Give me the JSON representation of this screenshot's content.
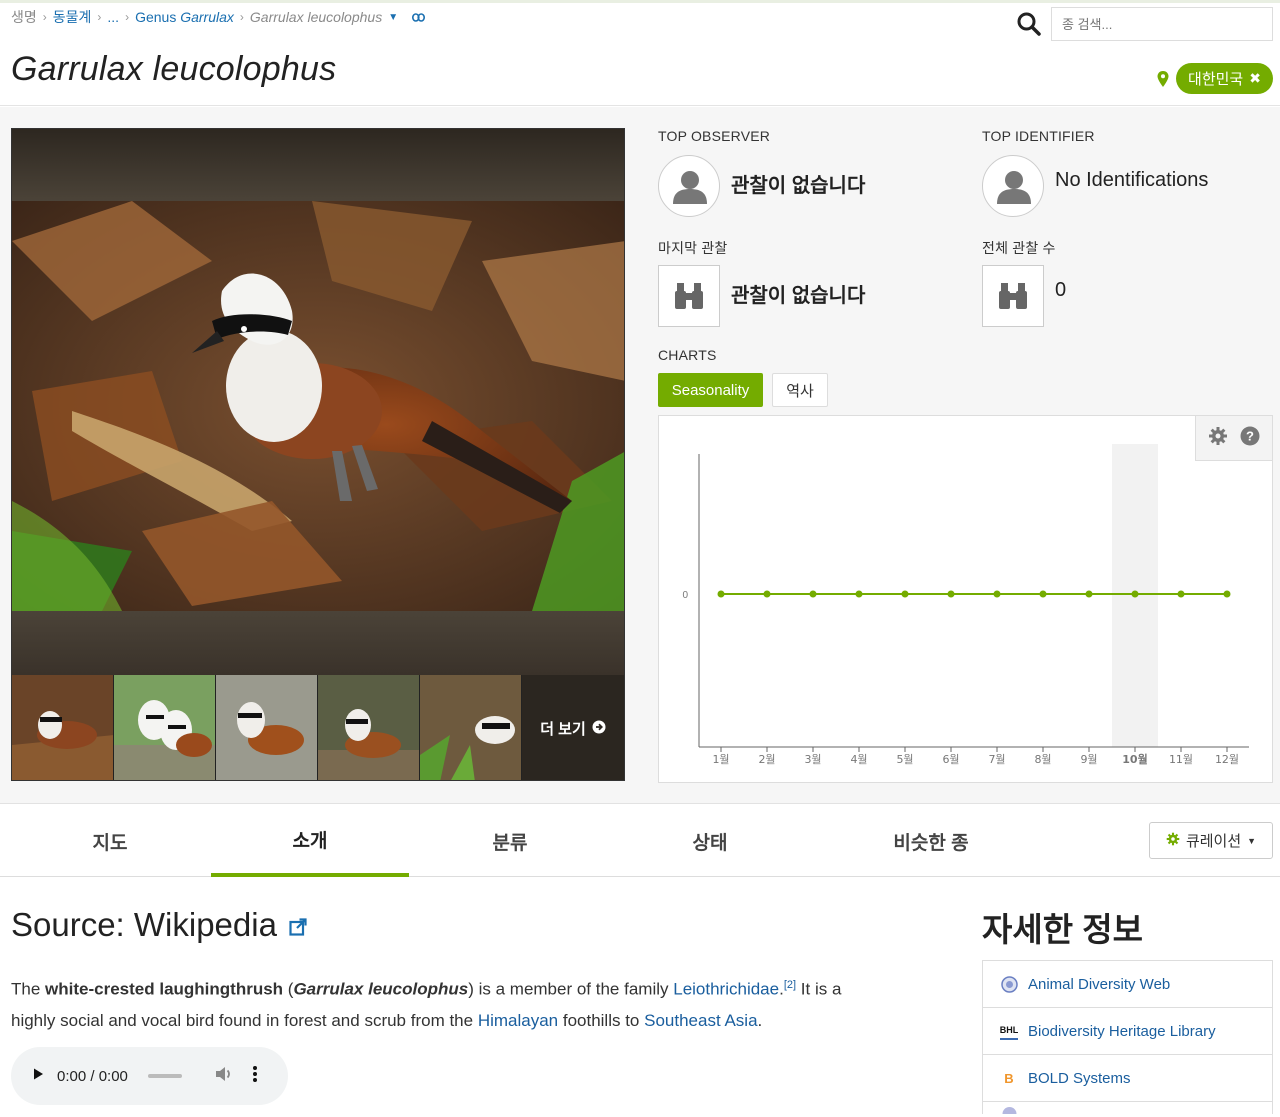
{
  "breadcrumb": {
    "items": [
      "생명",
      "동물계",
      "...",
      "Genus"
    ],
    "genus_name": "Garrulax",
    "current": "Garrulax leucolophus"
  },
  "page": {
    "title": "Garrulax leucolophus"
  },
  "search": {
    "placeholder": "종 검색..."
  },
  "place": {
    "label": "대한민국"
  },
  "photo": {
    "more_label": "더 보기"
  },
  "stats": {
    "top_observer_label": "TOP OBSERVER",
    "top_observer_value": "관찰이 없습니다",
    "top_identifier_label": "TOP IDENTIFIER",
    "top_identifier_value": "No Identifications",
    "last_obs_label": "마지막 관찰",
    "last_obs_value": "관찰이 없습니다",
    "total_obs_label": "전체 관찰 수",
    "total_obs_value": "0"
  },
  "charts": {
    "label": "CHARTS",
    "tabs": [
      "Seasonality",
      "역사"
    ],
    "active_tab": "Seasonality"
  },
  "chart_data": {
    "type": "line",
    "categories": [
      "1월",
      "2월",
      "3월",
      "4월",
      "5월",
      "6월",
      "7월",
      "8월",
      "9월",
      "10월",
      "11월",
      "12월"
    ],
    "series": [
      {
        "values": [
          0,
          0,
          0,
          0,
          0,
          0,
          0,
          0,
          0,
          0,
          0,
          0
        ]
      }
    ],
    "y_ticks": [
      "0"
    ],
    "highlighted_category": "10월",
    "line_color": "#74ac00"
  },
  "nav": {
    "tabs": [
      "지도",
      "소개",
      "분류",
      "상태",
      "비슷한 종"
    ],
    "active": "소개",
    "curation_label": "큐레이션"
  },
  "article": {
    "source_title": "Source: Wikipedia",
    "p1_a": "The ",
    "common_name": "white-crested laughingthrush",
    "p1_b": " (",
    "sci_name": "Garrulax leucolophus",
    "p1_c": ") is a member of the family ",
    "family_link": "Leiothrichidae",
    "p1_d": ".",
    "ref": "[2]",
    "p1_e": " It is a highly social and vocal bird found in forest and scrub from the ",
    "himalayan_link": "Himalayan",
    "p1_f": " foothills to ",
    "sea_link": "Southeast Asia",
    "p1_g": ".",
    "audio_time": "0:00 / 0:00"
  },
  "sidebar": {
    "title": "자세한 정보",
    "links": [
      {
        "label": "Animal Diversity Web",
        "icon": "globe-icon"
      },
      {
        "label": "Biodiversity Heritage Library",
        "icon": "bhl-icon",
        "icon_text": "BHL"
      },
      {
        "label": "BOLD Systems",
        "icon": "bold-icon",
        "icon_text": "B"
      }
    ]
  },
  "colors": {
    "accent": "#74ac00",
    "link": "#1a5e9e"
  }
}
